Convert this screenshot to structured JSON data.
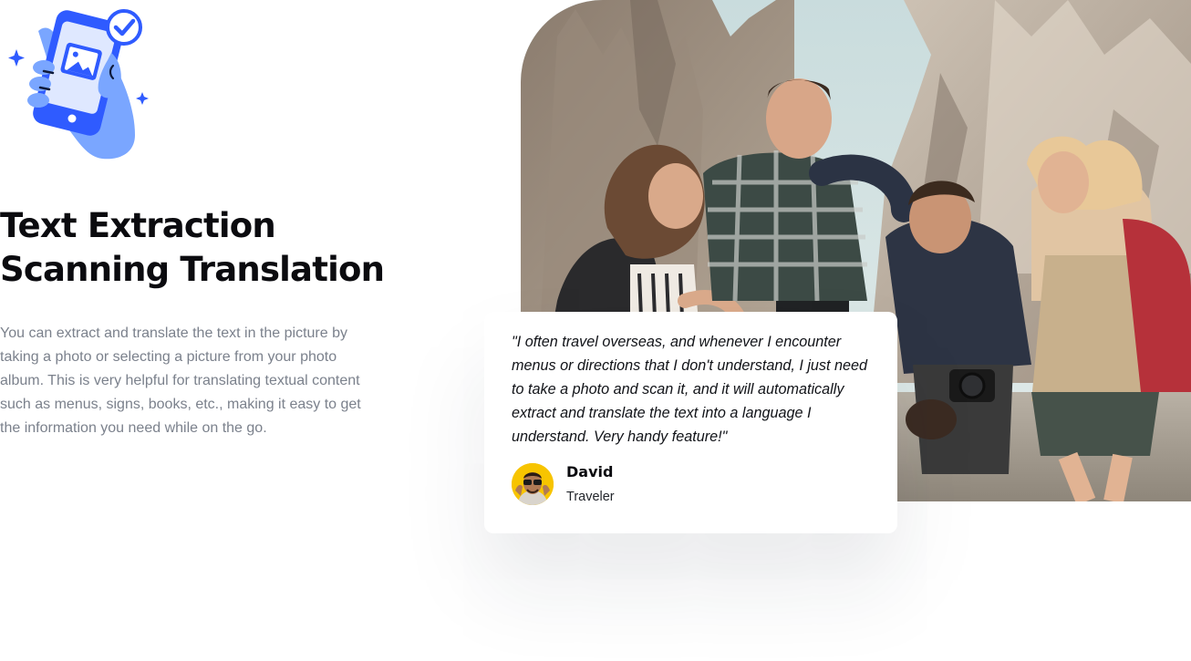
{
  "feature": {
    "illustration_icon": "phone-scan-check-icon",
    "title_line1": "Text Extraction",
    "title_line2": "Scanning Translation",
    "description": "You can extract and translate the text in the picture by taking a photo or selecting a picture from your photo album. This is very helpful for translating textual content such as menus, signs, books, etc., making it easy to get the information you need while on the go."
  },
  "testimonial": {
    "quote": "\"I often travel overseas, and whenever I encounter menus or directions that I don't understand, I just need to take a photo and scan it, and it will automatically extract and translate the text into a language I understand. Very handy feature!\"",
    "author_name": "David",
    "author_role": "Traveler"
  },
  "colors": {
    "brand_blue": "#2f5bff",
    "hand_blue": "#7aa6ff",
    "heading": "#0b0b0f",
    "body_text": "#7b818c",
    "avatar_bg": "#f7c400"
  }
}
